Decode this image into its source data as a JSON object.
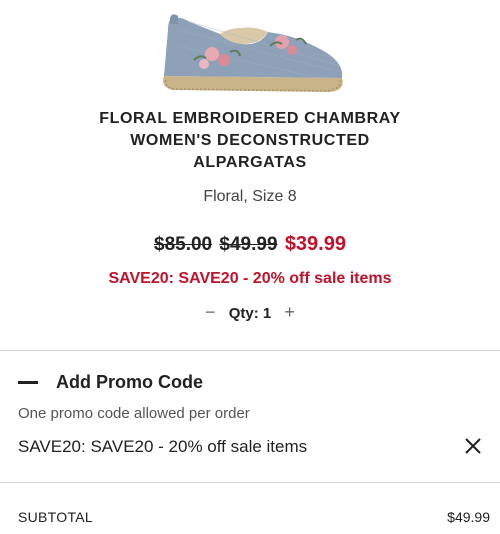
{
  "product": {
    "image_icon": "shoe-image",
    "title_lines": [
      "FLORAL EMBROIDERED CHAMBRAY",
      "WOMEN'S DECONSTRUCTED",
      "ALPARGATAS"
    ],
    "variant": "Floral, Size 8",
    "original_price": "$85.00",
    "sale_price": "$49.99",
    "final_price": "$39.99",
    "discount_text": "SAVE20: SAVE20 - 20% off sale items",
    "quantity": {
      "decrement": "−",
      "label": "Qty: 1",
      "increment": "+"
    }
  },
  "promo": {
    "collapse_icon": "minus-icon",
    "title": "Add Promo Code",
    "note": "One promo code allowed per order",
    "applied_code": "SAVE20: SAVE20 - 20% off sale items",
    "remove_icon": "close-icon"
  },
  "summary": {
    "subtotal_label": "SUBTOTAL",
    "subtotal_value": "$49.99"
  },
  "colors": {
    "accent_red": "#c0122a",
    "text": "#222222",
    "divider": "#d6d6d6"
  }
}
